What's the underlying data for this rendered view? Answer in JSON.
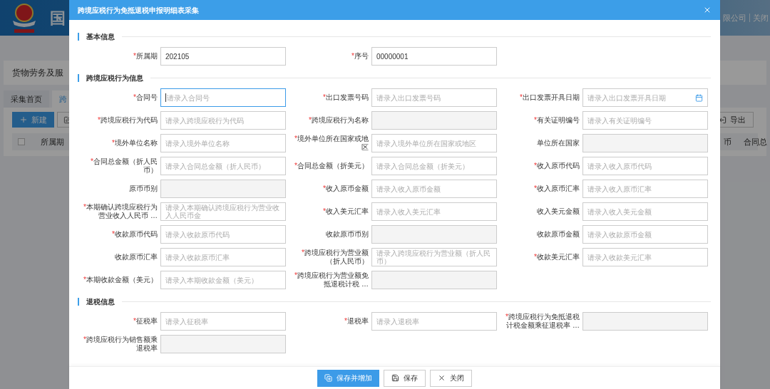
{
  "background": {
    "site_title": "国",
    "user_text": "限公司",
    "logout": "关闭",
    "breadcrumb": "货物劳务及服",
    "select_all_checked": false,
    "tabs": [
      {
        "label": "采集首页",
        "selected": false
      },
      {
        "label": "跨",
        "selected": true
      }
    ],
    "new_button": "新建",
    "export_button": "导出",
    "table_columns": [
      "所属期",
      "币",
      "合同总"
    ]
  },
  "required_mark": "*",
  "dialog": {
    "title": "跨境应税行为免抵退税申报明细表采集",
    "sections": [
      {
        "title": "基本信息",
        "fields": [
          {
            "label": "所属期",
            "required": true,
            "kind": "input",
            "value": "202105"
          },
          {
            "label": "序号",
            "required": true,
            "kind": "input",
            "value": "00000001"
          }
        ]
      },
      {
        "title": "跨境应税行为信息",
        "fields": [
          {
            "label": "合同号",
            "required": true,
            "kind": "input",
            "placeholder": "请录入合同号",
            "focused": true
          },
          {
            "label": "出口发票号码",
            "required": true,
            "kind": "input",
            "placeholder": "请录入出口发票号码"
          },
          {
            "label": "出口发票开具日期",
            "required": true,
            "kind": "date",
            "placeholder": "请录入出口发票开具日期"
          },
          {
            "label": "跨境应税行为代码",
            "required": true,
            "kind": "input",
            "placeholder": "请录入跨境应税行为代码"
          },
          {
            "label": "跨境应税行为名称",
            "required": true,
            "kind": "readonly"
          },
          {
            "label": "有关证明编号",
            "required": true,
            "kind": "input",
            "placeholder": "请录入有关证明编号"
          },
          {
            "label": "境外单位名称",
            "required": true,
            "kind": "input",
            "placeholder": "请录入境外单位名称"
          },
          {
            "label": "境外单位所在国家或地区",
            "required": true,
            "kind": "input",
            "placeholder": "请录入境外单位所在国家或地区"
          },
          {
            "label": "单位所在国家",
            "required": false,
            "kind": "readonly"
          },
          {
            "label": "合同总金额（折人民币）",
            "required": true,
            "kind": "input",
            "placeholder": "请录入合同总金额（折人民币）"
          },
          {
            "label": "合同总金额（折美元）",
            "required": true,
            "kind": "input",
            "placeholder": "请录入合同总金额（折美元）"
          },
          {
            "label": "收入原币代码",
            "required": true,
            "kind": "input",
            "placeholder": "请录入收入原币代码"
          },
          {
            "label": "原币币别",
            "required": false,
            "kind": "readonly"
          },
          {
            "label": "收入原币金额",
            "required": true,
            "kind": "input",
            "placeholder": "请录入收入原币金额"
          },
          {
            "label": "收入原币汇率",
            "required": true,
            "kind": "input",
            "placeholder": "请录入收入原币汇率"
          },
          {
            "label": "本期确认跨境应税行为营业收入人民币 …",
            "required": true,
            "kind": "input",
            "placeholder": "请录入本期确认跨境应税行为营业收入人民币金"
          },
          {
            "label": "收入美元汇率",
            "required": true,
            "kind": "input",
            "placeholder": "请录入收入美元汇率"
          },
          {
            "label": "收入美元金额",
            "required": false,
            "kind": "input",
            "placeholder": "请录入收入美元金额"
          },
          {
            "label": "收款原币代码",
            "required": true,
            "kind": "input",
            "placeholder": "请录入收款原币代码"
          },
          {
            "label": "收款原币币别",
            "required": false,
            "kind": "readonly"
          },
          {
            "label": "收款原币金额",
            "required": false,
            "kind": "input",
            "placeholder": "请录入收款原币金额"
          },
          {
            "label": "收款原币汇率",
            "required": false,
            "kind": "input",
            "placeholder": "请录入收款原币汇率"
          },
          {
            "label": "跨境应税行为营业额（折人民币）",
            "required": true,
            "kind": "input",
            "placeholder": "请录入跨境应税行为营业额（折人民币）"
          },
          {
            "label": "收款美元汇率",
            "required": true,
            "kind": "input",
            "placeholder": "请录入收款美元汇率"
          },
          {
            "label": "本期收款金额（美元）",
            "required": true,
            "kind": "input",
            "placeholder": "请录入本期收款金额（美元）"
          },
          {
            "label": "跨境应税行为营业额免抵退税计税 …",
            "required": true,
            "kind": "readonly"
          }
        ]
      },
      {
        "title": "退税信息",
        "fields": [
          {
            "label": "征税率",
            "required": true,
            "kind": "input",
            "placeholder": "请录入征税率"
          },
          {
            "label": "退税率",
            "required": true,
            "kind": "input",
            "placeholder": "请录入退税率"
          },
          {
            "label": "跨境应税行为免抵退税计税金额乘征退税率 …",
            "required": true,
            "kind": "readonly"
          },
          {
            "label": "跨境应税行为销售额乘退税率",
            "required": true,
            "kind": "readonly"
          }
        ]
      }
    ],
    "buttons": [
      {
        "label": "保存并增加",
        "kind": "primary"
      },
      {
        "label": "保存",
        "kind": "save"
      },
      {
        "label": "关闭",
        "kind": "close"
      }
    ]
  }
}
